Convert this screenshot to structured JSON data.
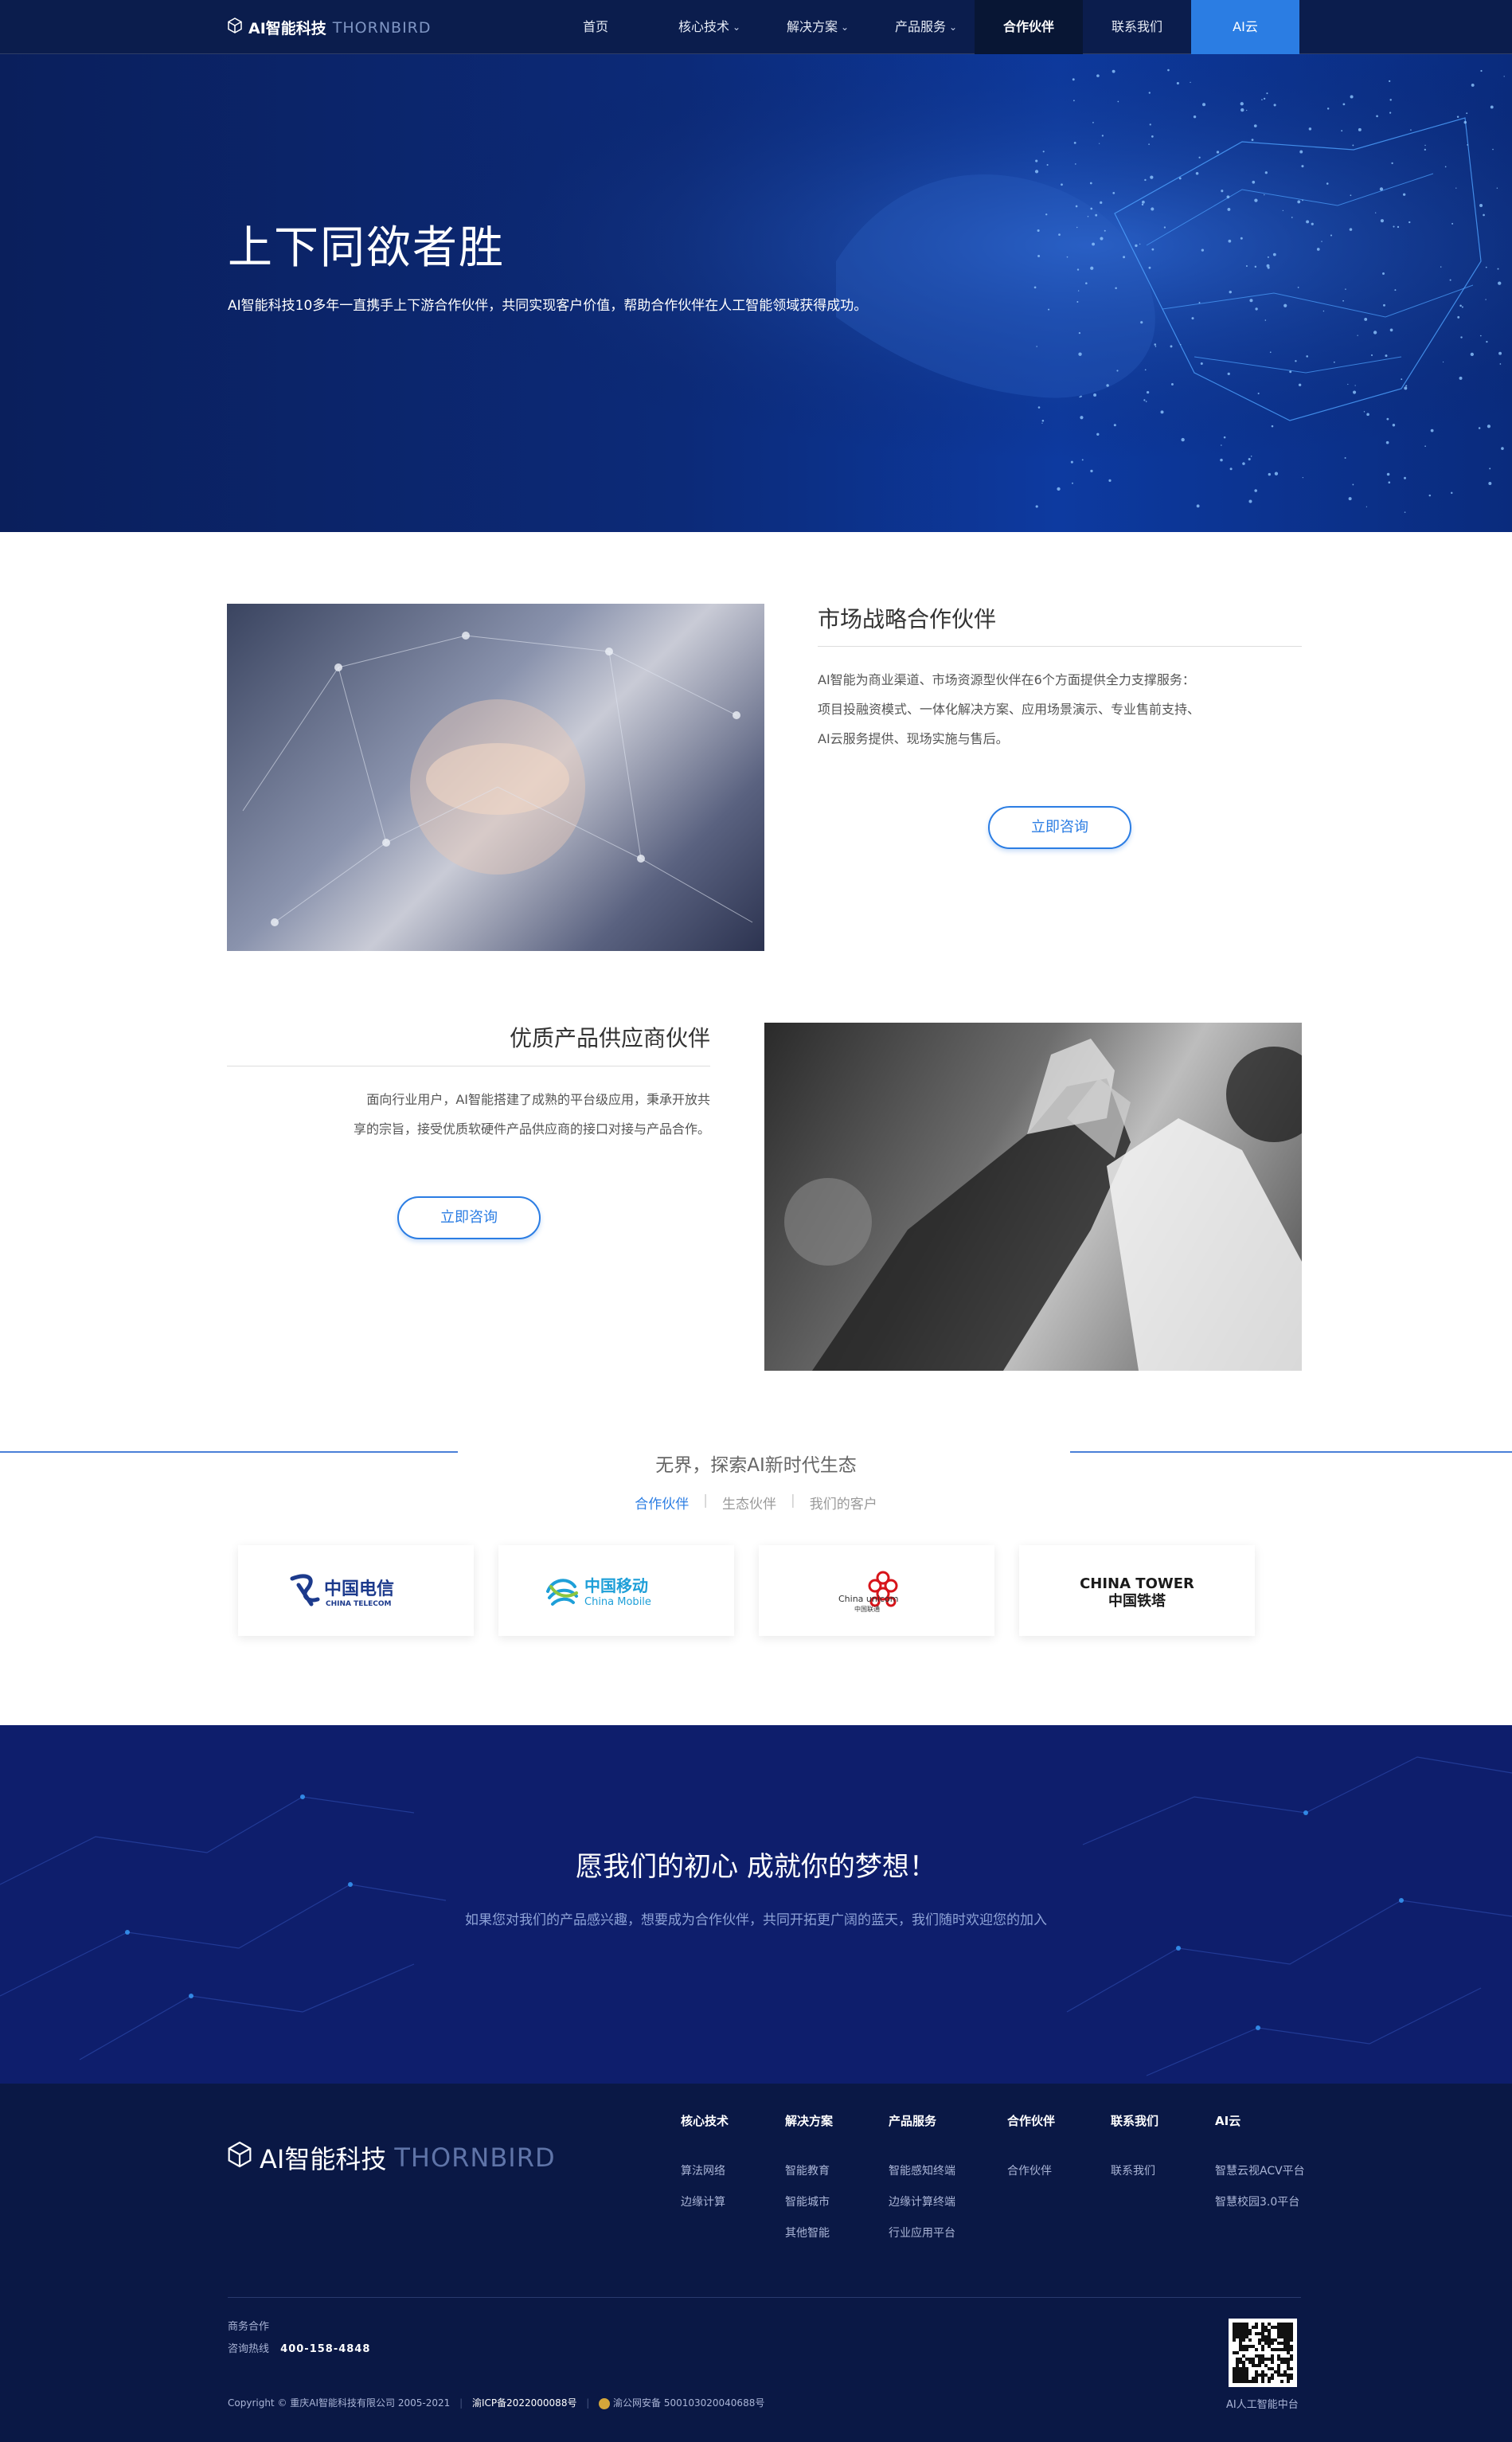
{
  "nav": {
    "logo_cn": "AI智能科技",
    "logo_en": "THORNBIRD",
    "items": [
      {
        "label": "首页"
      },
      {
        "label": "核心技术"
      },
      {
        "label": "解决方案"
      },
      {
        "label": "产品服务"
      },
      {
        "label": "合作伙伴"
      },
      {
        "label": "联系我们"
      },
      {
        "label": "AI云"
      }
    ]
  },
  "hero": {
    "title": "上下同欲者胜",
    "subtitle": "AI智能科技10多年一直携手上下游合作伙伴，共同实现客户价值，帮助合作伙伴在人工智能领域获得成功。"
  },
  "strategy": {
    "title": "市场战略合作伙伴",
    "lines": [
      "AI智能为商业渠道、市场资源型伙伴在6个方面提供全力支撑服务：",
      "项目投融资模式、一体化解决方案、应用场景演示、专业售前支持、",
      "AI云服务提供、现场实施与售后。"
    ],
    "button": "立即咨询"
  },
  "supplier": {
    "title": "优质产品供应商伙伴",
    "lines": [
      "面向行业用户，AI智能搭建了成熟的平台级应用，秉承开放共",
      "享的宗旨，接受优质软硬件产品供应商的接口对接与产品合作。"
    ],
    "button": "立即咨询"
  },
  "ecosystem": {
    "title": "无界，探索AI新时代生态",
    "tabs": [
      "合作伙伴",
      "生态伙伴",
      "我们的客户"
    ],
    "logos": [
      {
        "cn": "中国电信",
        "en": "CHINA TELECOM"
      },
      {
        "cn": "中国移动",
        "en": "China Mobile"
      },
      {
        "cn": "中国联通",
        "en": "China unicom"
      },
      {
        "cn": "中国铁塔",
        "en": "CHINA TOWER"
      }
    ]
  },
  "banner": {
    "title": "愿我们的初心 成就你的梦想！",
    "text": "如果您对我们的产品感兴趣，想要成为合作伙伴，共同开拓更广阔的蓝天，我们随时欢迎您的加入"
  },
  "footer": {
    "logo_cn": "AI智能科技",
    "logo_en": "THORNBIRD",
    "columns": [
      {
        "title": "核心技术",
        "links": [
          "算法网络",
          "边缘计算"
        ]
      },
      {
        "title": "解决方案",
        "links": [
          "智能教育",
          "智能城市",
          "其他智能"
        ]
      },
      {
        "title": "产品服务",
        "links": [
          "智能感知终端",
          "边缘计算终端",
          "行业应用平台"
        ]
      },
      {
        "title": "合作伙伴",
        "links": [
          "合作伙伴"
        ]
      },
      {
        "title": "联系我们",
        "links": [
          "联系我们"
        ]
      },
      {
        "title": "AI云",
        "links": [
          "智慧云视ACV平台",
          "智慧校园3.0平台"
        ]
      }
    ],
    "business": "商务合作",
    "hotline_label": "咨询热线",
    "hotline": "400-158-4848",
    "copyright": "Copyright © 重庆AI智能科技有限公司 2005-2021",
    "icp": "渝ICP备2022000088号",
    "police": "渝公网安备 500103020040688号",
    "qr_caption": "AI人工智能中台"
  },
  "colors": {
    "accent": "#2b7de3",
    "nav_bg": "#0b1d4d",
    "footer_bg": "#0a1845"
  }
}
